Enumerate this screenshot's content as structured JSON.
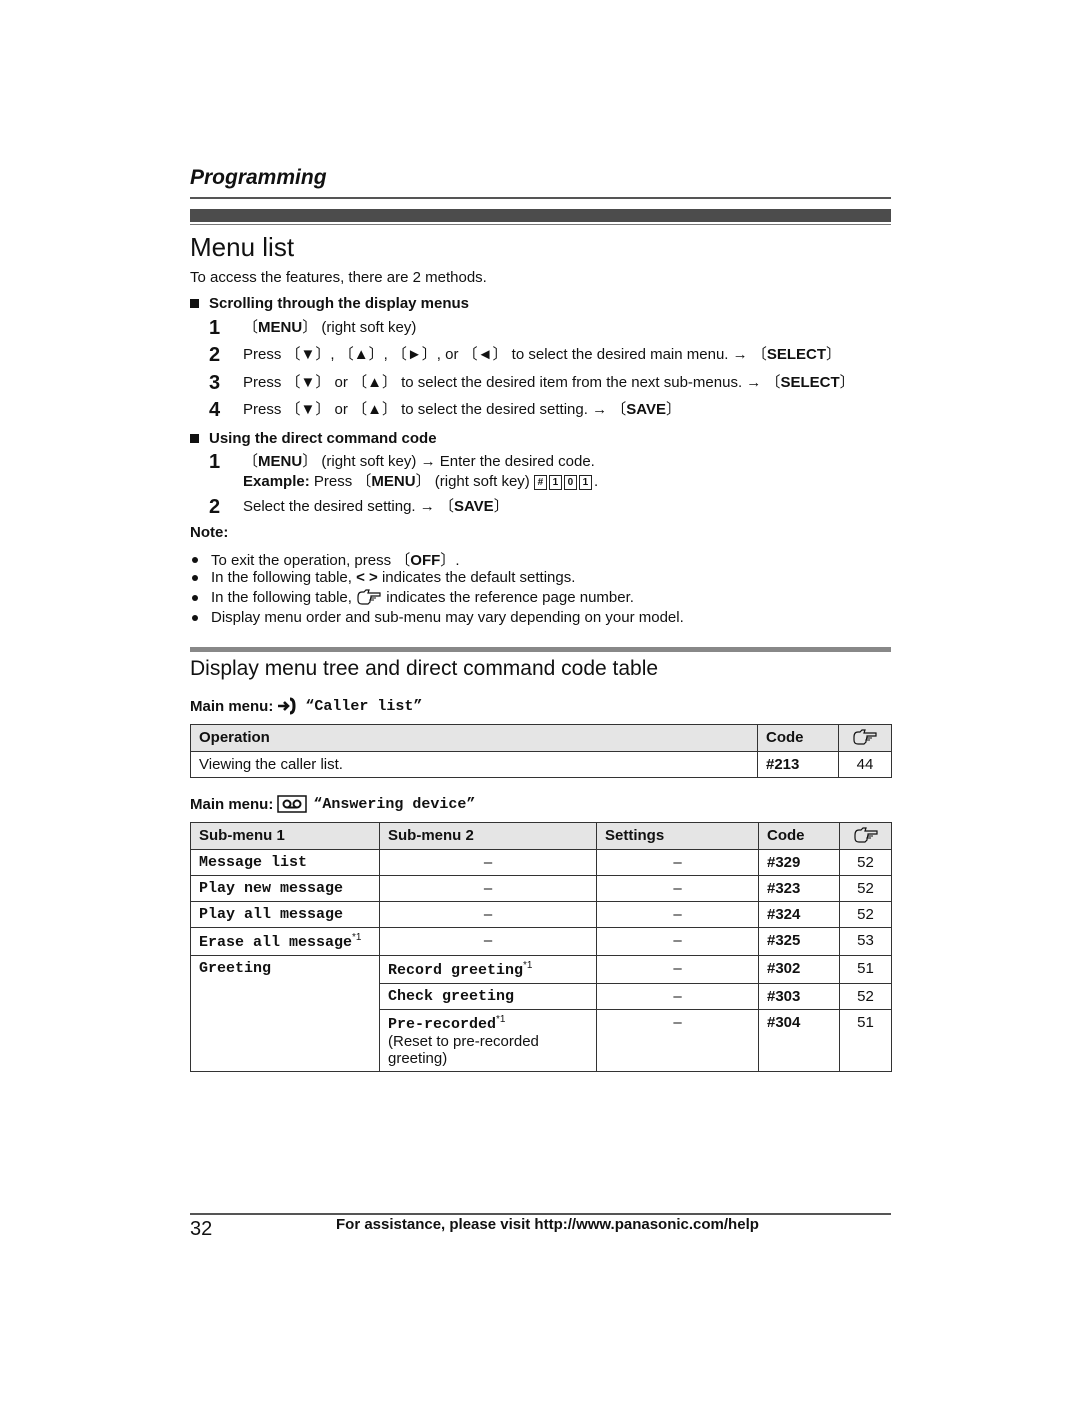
{
  "header": {
    "section": "Programming",
    "title": "Menu list",
    "intro": "To access the features, there are 2 methods."
  },
  "method1": {
    "heading": "Scrolling through the display menus",
    "steps": [
      {
        "num": "1",
        "key": "MENU",
        "text": " (right soft key)"
      },
      {
        "num": "2",
        "text_a": "Press ",
        "keys": [
          "▼",
          "▲",
          "►",
          "◄"
        ],
        "text_b": " to select the desired main menu. → ",
        "end_key": "SELECT"
      },
      {
        "num": "3",
        "text_a": "Press ",
        "keys": [
          "▼",
          "▲"
        ],
        "text_b": " to select the desired item from the next sub-menus. → ",
        "end_key": "SELECT"
      },
      {
        "num": "4",
        "text_a": "Press ",
        "keys": [
          "▼",
          "▲"
        ],
        "text_b": " to select the desired setting. → ",
        "end_key": "SAVE"
      }
    ]
  },
  "method2": {
    "heading": "Using the direct command code",
    "step1_key": "MENU",
    "step1_text": " (right soft key) → Enter the desired code.",
    "example_label": "Example:",
    "example_text": " Press ",
    "example_key": "MENU",
    "example_text2": " (right soft key) ",
    "example_keys": [
      "#",
      "1",
      "0",
      "1"
    ],
    "step2_text": "Select the desired setting. → ",
    "step2_key": "SAVE"
  },
  "notes": {
    "label": "Note:",
    "items": [
      {
        "pre": "To exit the operation, press ",
        "key": "OFF",
        "post": "."
      },
      {
        "pre": "In the following table, ",
        "bold": "< >",
        "post": " indicates the default settings."
      },
      {
        "pre": "In the following table, ",
        "icon": "pointing-hand-icon",
        "post": " indicates the reference page number."
      },
      {
        "pre": "Display menu order and sub-menu may vary depending on your model."
      }
    ]
  },
  "table_section": {
    "heading": "Display menu tree and direct command code table"
  },
  "caller_list": {
    "label": "Main menu: ",
    "icon": "incoming-call-icon",
    "name": "“Caller list”",
    "headers": [
      "Operation",
      "Code"
    ],
    "rows": [
      {
        "operation": "Viewing the caller list.",
        "code": "#213",
        "page": "44"
      }
    ]
  },
  "answering_device": {
    "label": "Main menu: ",
    "icon": "answering-machine-icon",
    "name": "“Answering device”",
    "headers": [
      "Sub-menu 1",
      "Sub-menu 2",
      "Settings",
      "Code"
    ],
    "rows": [
      {
        "sub1": "Message list",
        "sub2": "–",
        "settings": "–",
        "code": "#329",
        "page": "52"
      },
      {
        "sub1": "Play new message",
        "sub2": "–",
        "settings": "–",
        "code": "#323",
        "page": "52"
      },
      {
        "sub1": "Play all message",
        "sub2": "–",
        "settings": "–",
        "code": "#324",
        "page": "52"
      },
      {
        "sub1": "Erase all message",
        "sub1_note": "*1",
        "sub2": "–",
        "settings": "–",
        "code": "#325",
        "page": "53"
      },
      {
        "sub1": "Greeting",
        "sub2": "Record greeting",
        "sub2_note": "*1",
        "settings": "–",
        "code": "#302",
        "page": "51"
      },
      {
        "sub2": "Check greeting",
        "settings": "–",
        "code": "#303",
        "page": "52"
      },
      {
        "sub2": "Pre-recorded",
        "sub2_note": "*1",
        "sub2_desc": "(Reset to pre-recorded greeting)",
        "settings": "–",
        "code": "#304",
        "page": "51"
      }
    ]
  },
  "footer": {
    "page_number": "32",
    "text": "For assistance, please visit http://www.panasonic.com/help"
  }
}
